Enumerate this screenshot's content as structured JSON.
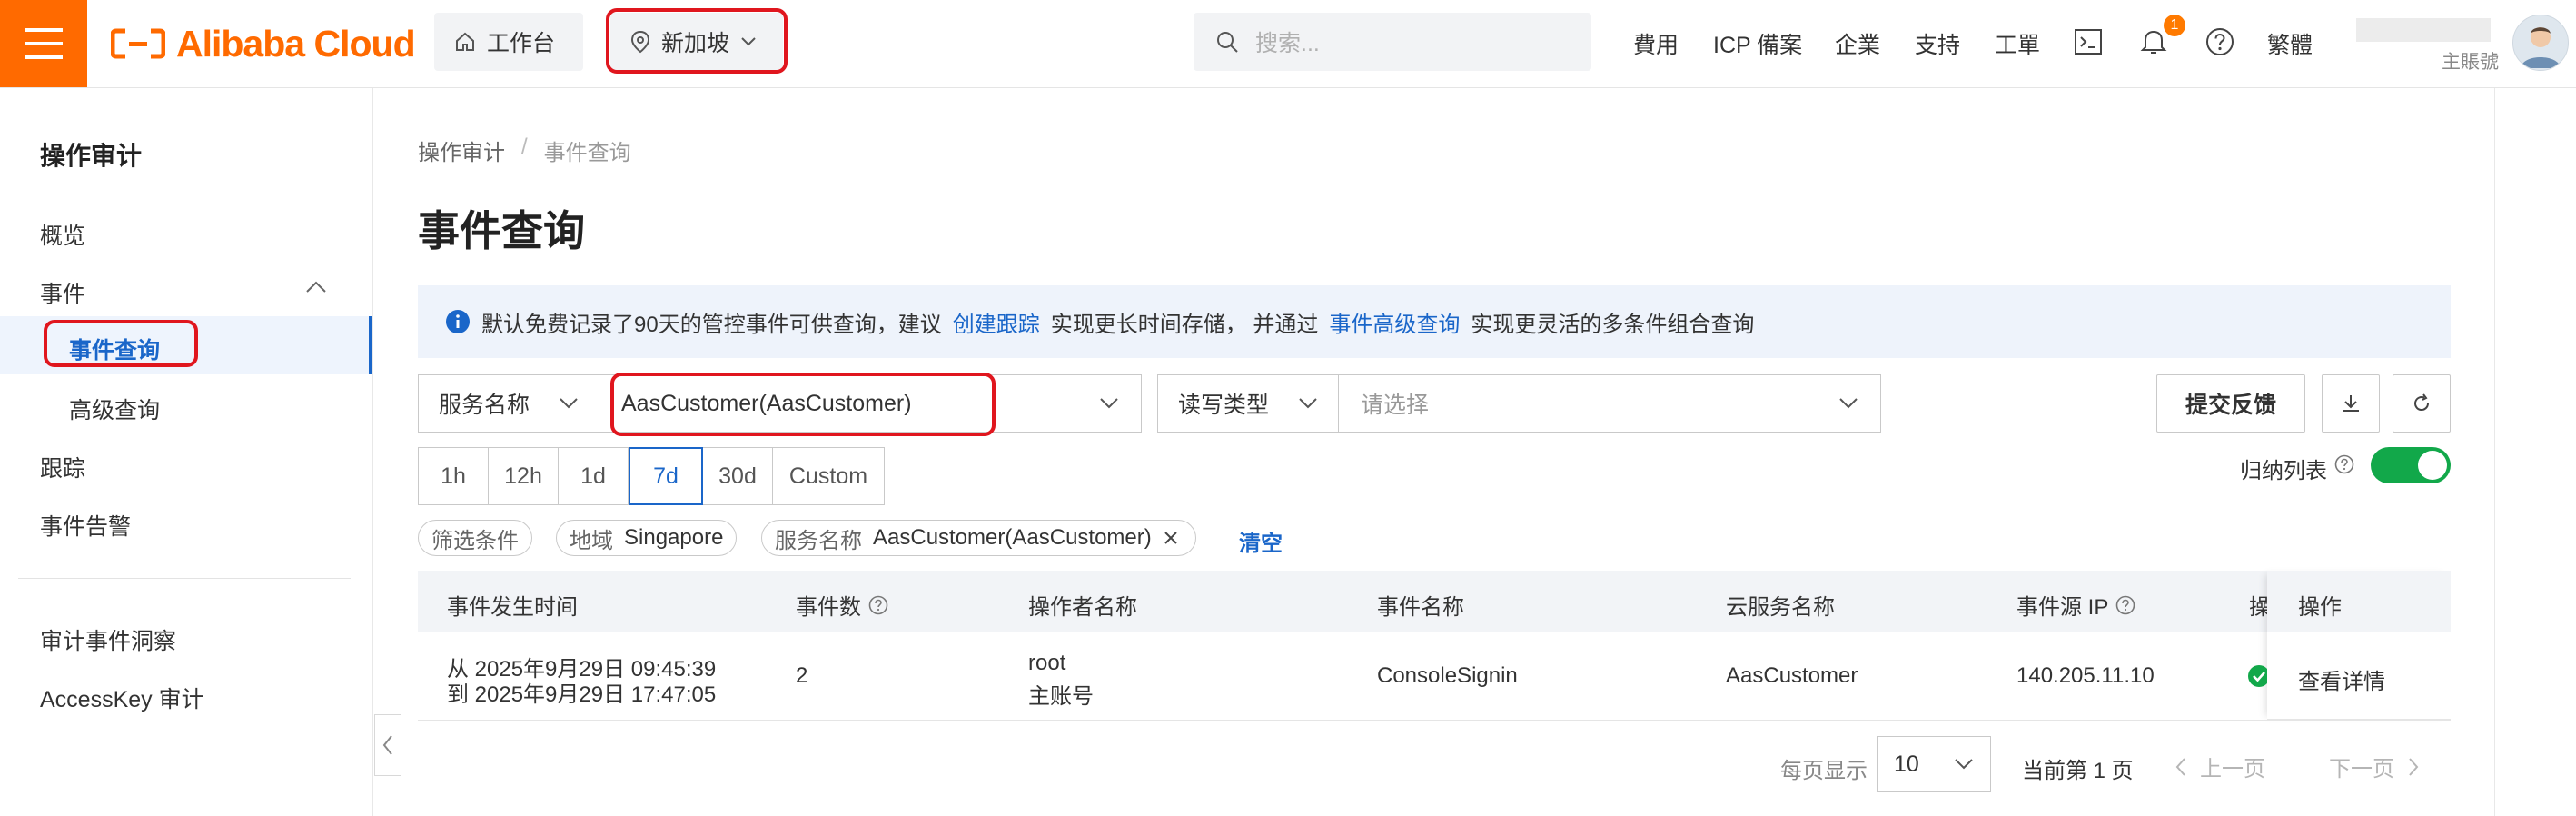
{
  "header": {
    "logo_text": "Alibaba Cloud",
    "workbench_label": "工作台",
    "region_label": "新加坡",
    "search_placeholder": "搜索...",
    "nav": [
      "費用",
      "ICP 備案",
      "企業",
      "支持",
      "工單"
    ],
    "notification_count": "1",
    "lang_label": "繁體",
    "account_sub": "主賬號",
    "brand_color": "#ff6a00"
  },
  "sidebar": {
    "title": "操作审计",
    "items": {
      "overview": "概览",
      "events": "事件",
      "event_query": "事件查询",
      "advanced_query": "高级查询",
      "trails": "跟踪",
      "event_alerts": "事件告警",
      "insights": "审计事件洞察",
      "accesskey_audit": "AccessKey 审计"
    }
  },
  "main": {
    "breadcrumb": [
      "操作审计",
      "/",
      "事件查询"
    ],
    "title": "事件查询",
    "notice": {
      "part1": "默认免费记录了90天的管控事件可供查询，建议",
      "link1": "创建跟踪",
      "part2": "实现更长时间存储，  并通过",
      "link2": "事件高级查询",
      "part3": "实现更灵活的多条件组合查询"
    },
    "filters": {
      "field1_label": "服务名称",
      "field1_value": "AasCustomer(AasCustomer)",
      "field2_label": "读写类型",
      "field2_placeholder": "请选择"
    },
    "buttons": {
      "feedback": "提交反馈"
    },
    "time_ranges": [
      "1h",
      "12h",
      "1d",
      "7d",
      "30d",
      "Custom"
    ],
    "active_range": "7d",
    "group_list_label": "归纳列表",
    "group_list_on": true,
    "tags": {
      "filter_label": "筛选条件",
      "region_key": "地域",
      "region_value": "Singapore",
      "service_key": "服务名称",
      "service_value": "AasCustomer(AasCustomer)",
      "clear": "清空"
    },
    "table": {
      "columns": [
        "事件发生时间",
        "事件数",
        "操作者名称",
        "事件名称",
        "云服务名称",
        "事件源 IP",
        "操",
        "操作"
      ],
      "rows": [
        {
          "time_from": "从 2025年9月29日 09:45:39",
          "time_to": "到 2025年9月29日 17:47:05",
          "count": "2",
          "operator": "root",
          "operator_type": "主账号",
          "event_name": "ConsoleSignin",
          "service": "AasCustomer",
          "source_ip": "140.205.11.10",
          "action": "查看详情"
        }
      ]
    },
    "pagination": {
      "page_size_label": "每页显示",
      "page_size": "10",
      "current_page": "当前第 1 页",
      "prev": "上一页",
      "next": "下一页"
    }
  }
}
